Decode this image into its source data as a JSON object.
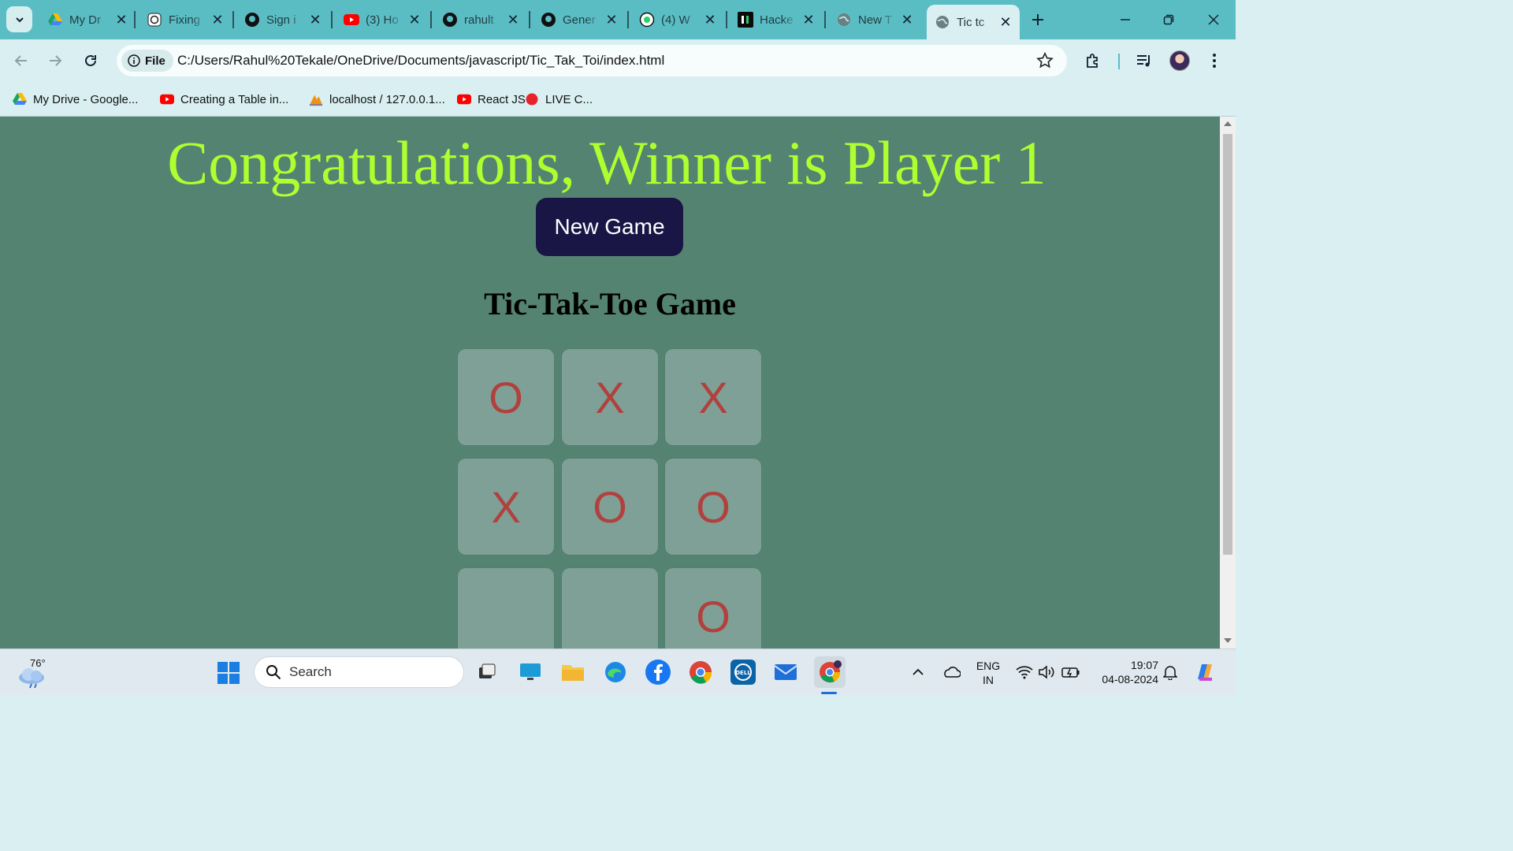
{
  "browser": {
    "tabs": [
      {
        "title": "My Dr",
        "icon": "google-drive-icon"
      },
      {
        "title": "Fixing",
        "icon": "openai-icon"
      },
      {
        "title": "Sign i",
        "icon": "github-icon"
      },
      {
        "title": "(3) Ho",
        "icon": "youtube-icon"
      },
      {
        "title": "rahult",
        "icon": "github-icon"
      },
      {
        "title": "Gener",
        "icon": "github-icon"
      },
      {
        "title": "(4) W",
        "icon": "whatsapp-icon"
      },
      {
        "title": "Hacke",
        "icon": "hackerrank-icon"
      },
      {
        "title": "New T",
        "icon": "globe-icon"
      },
      {
        "title": "Tic tc",
        "icon": "globe-icon",
        "active": true
      }
    ],
    "address": {
      "chip_label": "File",
      "url": "C:/Users/Rahul%20Tekale/OneDrive/Documents/javascript/Tic_Tak_Toi/index.html"
    },
    "bookmarks": [
      {
        "label": "My Drive - Google...",
        "icon": "google-drive-icon"
      },
      {
        "label": "Creating a Table in...",
        "icon": "youtube-icon"
      },
      {
        "label": "localhost / 127.0.0.1...",
        "icon": "phpmyadmin-icon"
      },
      {
        "label": "React JS",
        "icon": "youtube-icon"
      },
      {
        "label": "LIVE C...",
        "icon": "red-dot-icon"
      }
    ]
  },
  "game": {
    "winner_message": "Congratulations, Winner is Player 1",
    "new_game_label": "New Game",
    "title": "Tic-Tak-Toe Game",
    "board": [
      "O",
      "X",
      "X",
      "X",
      "O",
      "O",
      "",
      "",
      "O"
    ],
    "colors": {
      "background": "#558372",
      "message": "#adff2f",
      "button": "#191645",
      "cell": "#7fa096",
      "mark": "#b0413e"
    }
  },
  "taskbar": {
    "weather_temp": "76°",
    "search_placeholder": "Search",
    "apps": [
      "task-view-icon",
      "desktop-icon",
      "file-explorer-icon",
      "edge-icon",
      "facebook-icon",
      "chrome-icon",
      "dell-icon",
      "mail-icon",
      "chrome-profile-icon"
    ],
    "language_line1": "ENG",
    "language_line2": "IN",
    "time": "19:07",
    "date": "04-08-2024"
  }
}
